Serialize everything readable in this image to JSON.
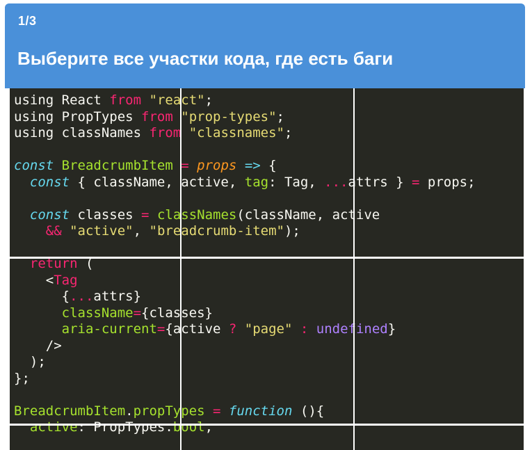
{
  "header": {
    "counter": "1/3",
    "question": "Выберите все участки кода, где есть баги"
  },
  "code": {
    "lines": [
      [
        [
          "t",
          "using React "
        ],
        [
          "kw",
          "from"
        ],
        [
          "t",
          " "
        ],
        [
          "st",
          "\"react\""
        ],
        [
          "t",
          ";"
        ]
      ],
      [
        [
          "t",
          "using PropTypes "
        ],
        [
          "kw",
          "from"
        ],
        [
          "t",
          " "
        ],
        [
          "st",
          "\"prop-types\""
        ],
        [
          "t",
          ";"
        ]
      ],
      [
        [
          "t",
          "using classNames "
        ],
        [
          "kw",
          "from"
        ],
        [
          "t",
          " "
        ],
        [
          "st",
          "\"classnames\""
        ],
        [
          "t",
          ";"
        ]
      ],
      [],
      [
        [
          "it",
          "const"
        ],
        [
          "t",
          " "
        ],
        [
          "gr",
          "BreadcrumbItem"
        ],
        [
          "t",
          " "
        ],
        [
          "op",
          "="
        ],
        [
          "t",
          " "
        ],
        [
          "fn",
          "props"
        ],
        [
          "t",
          " "
        ],
        [
          "it",
          "=>"
        ],
        [
          "t",
          " {"
        ]
      ],
      [
        [
          "t",
          "  "
        ],
        [
          "it",
          "const"
        ],
        [
          "t",
          " { className, active, "
        ],
        [
          "gr",
          "tag"
        ],
        [
          "t",
          ": Tag, "
        ],
        [
          "op",
          "..."
        ],
        [
          "t",
          "attrs } "
        ],
        [
          "op",
          "="
        ],
        [
          "t",
          " props;"
        ]
      ],
      [],
      [
        [
          "t",
          "  "
        ],
        [
          "it",
          "const"
        ],
        [
          "t",
          " classes "
        ],
        [
          "op",
          "="
        ],
        [
          "t",
          " "
        ],
        [
          "gr",
          "classNames"
        ],
        [
          "t",
          "(className, active"
        ]
      ],
      [
        [
          "t",
          "    "
        ],
        [
          "op",
          "&&"
        ],
        [
          "t",
          " "
        ],
        [
          "st",
          "\"active\""
        ],
        [
          "t",
          ", "
        ],
        [
          "st",
          "\"breadcrumb-item\""
        ],
        [
          "t",
          ");"
        ]
      ],
      [],
      [
        [
          "t",
          "  "
        ],
        [
          "kw",
          "return"
        ],
        [
          "t",
          " ("
        ]
      ],
      [
        [
          "t",
          "    <"
        ],
        [
          "kw",
          "Tag"
        ]
      ],
      [
        [
          "t",
          "      {"
        ],
        [
          "op",
          "..."
        ],
        [
          "t",
          "attrs}"
        ]
      ],
      [
        [
          "t",
          "      "
        ],
        [
          "gr",
          "className"
        ],
        [
          "op",
          "="
        ],
        [
          "t",
          "{classes}"
        ]
      ],
      [
        [
          "t",
          "      "
        ],
        [
          "gr",
          "aria-current"
        ],
        [
          "op",
          "="
        ],
        [
          "t",
          "{active "
        ],
        [
          "op",
          "?"
        ],
        [
          "t",
          " "
        ],
        [
          "st",
          "\"page\""
        ],
        [
          "t",
          " "
        ],
        [
          "op",
          ":"
        ],
        [
          "t",
          " "
        ],
        [
          "pu",
          "undefined"
        ],
        [
          "t",
          "}"
        ]
      ],
      [
        [
          "t",
          "    />"
        ]
      ],
      [
        [
          "t",
          "  );"
        ]
      ],
      [
        [
          "t",
          "};"
        ]
      ],
      [],
      [
        [
          "gr",
          "BreadcrumbItem"
        ],
        [
          "t",
          "."
        ],
        [
          "gr",
          "propTypes"
        ],
        [
          "t",
          " "
        ],
        [
          "op",
          "="
        ],
        [
          "t",
          " "
        ],
        [
          "it",
          "function"
        ],
        [
          "t",
          " (){"
        ]
      ],
      [
        [
          "t",
          "  "
        ],
        [
          "gr",
          "active"
        ],
        [
          "t",
          ": PropTypes."
        ],
        [
          "gr",
          "bool"
        ],
        [
          "t",
          ","
        ]
      ]
    ]
  },
  "colors": {
    "header_bg": "#4a90d9",
    "code_bg": "#272822",
    "keyword": "#f92672",
    "string": "#e6db74",
    "storage": "#66d9ef",
    "entity": "#a6e22e",
    "param": "#fd971f",
    "constant": "#ae81ff"
  }
}
